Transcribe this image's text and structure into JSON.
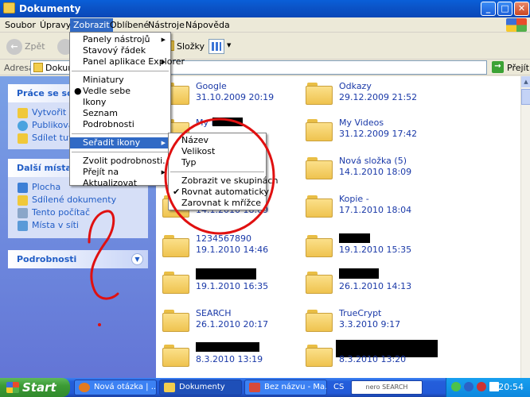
{
  "window": {
    "title": "Dokumenty",
    "buttons": {
      "minimize": "_",
      "maximize": "□",
      "close": "✕"
    }
  },
  "menubar": {
    "items": [
      "Soubor",
      "Úpravy",
      "Zobrazit",
      "Oblíbené",
      "Nástroje",
      "Nápověda"
    ],
    "active": "Zobrazit"
  },
  "toolbar": {
    "back_label": "Zpět",
    "folders_label": "Složky"
  },
  "address": {
    "label": "Adresa",
    "value": "Dokume",
    "go_label": "Přejít"
  },
  "taskpane": {
    "tasks": {
      "title": "Práce se soubory",
      "links": [
        "Vytvořit nov",
        "Publikovat s",
        "Sdílet tuto s"
      ]
    },
    "other_places": {
      "title": "Další místa",
      "links": [
        "Plocha",
        "Sdílené dokumenty",
        "Tento počítač",
        "Místa v síti"
      ]
    },
    "details": {
      "title": "Podrobnosti"
    }
  },
  "files": [
    {
      "name": "Google",
      "date": "31.10.2009 20:19"
    },
    {
      "name": "Odkazy",
      "date": "29.12.2009 21:52"
    },
    {
      "name": "My Music",
      "date": ""
    },
    {
      "name": "My Videos",
      "date": "31.12.2009 17:42"
    },
    {
      "name": "",
      "date": ""
    },
    {
      "name": "Nová složka (5)",
      "date": "14.1.2010 18:09"
    },
    {
      "name": "",
      "date": "14.1.2010 18:09"
    },
    {
      "name": "Kopie -",
      "date": "17.1.2010 18:04"
    },
    {
      "name": "1234567890",
      "date": "19.1.2010 14:46"
    },
    {
      "name": "",
      "date": "19.1.2010 15:35"
    },
    {
      "name": "",
      "date": "19.1.2010 16:35"
    },
    {
      "name": "",
      "date": "26.1.2010 14:13"
    },
    {
      "name": "SEARCH",
      "date": "26.1.2010 20:17"
    },
    {
      "name": "TrueCrypt",
      "date": "3.3.2010 9:17"
    },
    {
      "name": "",
      "date": "8.3.2010 13:19"
    },
    {
      "name": "",
      "date": "8.3.2010 13:20"
    }
  ],
  "view_menu": {
    "group1": [
      "Panely nástrojů",
      "Stavový řádek",
      "Panel aplikace Explorer"
    ],
    "group2": [
      "Miniatury",
      "Vedle sebe",
      "Ikony",
      "Seznam",
      "Podrobnosti"
    ],
    "group2_selected": "Vedle sebe",
    "group3": [
      "Seřadit ikony"
    ],
    "group4": [
      "Zvolit podrobnosti...",
      "Přejít na",
      "Aktualizovat"
    ]
  },
  "sort_menu": {
    "group1": [
      "Název",
      "Velikost",
      "Typ"
    ],
    "group2": [
      "Zobrazit ve skupinách",
      "Rovnat automaticky",
      "Zarovnat k mřížce"
    ],
    "checked": "Rovnat automaticky"
  },
  "taskbar": {
    "start_label": "Start",
    "tasks": [
      "Nová otázka | ...",
      "Dokumenty",
      "Bez názvu - Ma..."
    ],
    "active_task": "Dokumenty",
    "language": "CS",
    "search_brand": "nero SEARCH",
    "clock": "20:54"
  },
  "colors": {
    "titlebar": "#0b54c8",
    "menu_highlight": "#316ac5",
    "link_blue": "#1a39a8",
    "annotation_red": "#e01010"
  }
}
